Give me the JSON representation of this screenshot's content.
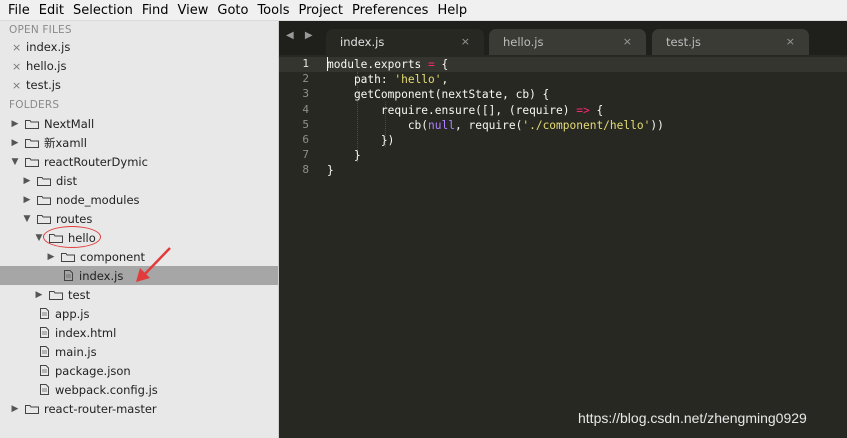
{
  "menu": [
    "File",
    "Edit",
    "Selection",
    "Find",
    "View",
    "Goto",
    "Tools",
    "Project",
    "Preferences",
    "Help"
  ],
  "sidebar": {
    "open_files_title": "OPEN FILES",
    "open_files": [
      "index.js",
      "hello.js",
      "test.js"
    ],
    "close_glyph": "×",
    "folders_title": "FOLDERS",
    "tree": [
      {
        "label": "NextMall",
        "type": "folder"
      },
      {
        "label": "新xamll",
        "type": "folder"
      },
      {
        "label": "reactRouterDymic",
        "type": "folder"
      },
      {
        "label": "dist",
        "type": "folder"
      },
      {
        "label": "node_modules",
        "type": "folder"
      },
      {
        "label": "routes",
        "type": "folder"
      },
      {
        "label": "hello",
        "type": "folder"
      },
      {
        "label": "component",
        "type": "folder"
      },
      {
        "label": "index.js",
        "type": "file"
      },
      {
        "label": "test",
        "type": "folder"
      },
      {
        "label": "app.js",
        "type": "file"
      },
      {
        "label": "index.html",
        "type": "file"
      },
      {
        "label": "main.js",
        "type": "file"
      },
      {
        "label": "package.json",
        "type": "file"
      },
      {
        "label": "webpack.config.js",
        "type": "file"
      },
      {
        "label": "react-router-master",
        "type": "folder"
      }
    ]
  },
  "editor": {
    "nav_arrows": "◀ ▶",
    "tabs": [
      {
        "label": "index.js",
        "close": "×",
        "active": true
      },
      {
        "label": "hello.js",
        "close": "×",
        "active": false
      },
      {
        "label": "test.js",
        "close": "×",
        "active": false
      }
    ],
    "line_numbers": [
      "1",
      "2",
      "3",
      "4",
      "5",
      "6",
      "7",
      "8"
    ],
    "code_lines": [
      [
        {
          "t": "module.exports ",
          "c": ""
        },
        {
          "t": "=",
          "c": "op"
        },
        {
          "t": " {",
          "c": ""
        }
      ],
      [
        {
          "t": "    path: ",
          "c": ""
        },
        {
          "t": "'hello'",
          "c": "str"
        },
        {
          "t": ",",
          "c": ""
        }
      ],
      [
        {
          "t": "    getComponent(nextState, cb) {",
          "c": ""
        }
      ],
      [
        {
          "t": "        require.ensure([], (require) ",
          "c": ""
        },
        {
          "t": "=>",
          "c": "op"
        },
        {
          "t": " {",
          "c": ""
        }
      ],
      [
        {
          "t": "            cb(",
          "c": ""
        },
        {
          "t": "null",
          "c": "cst"
        },
        {
          "t": ", require(",
          "c": ""
        },
        {
          "t": "'./component/hello'",
          "c": "str"
        },
        {
          "t": "))",
          "c": ""
        }
      ],
      [
        {
          "t": "        })",
          "c": ""
        }
      ],
      [
        {
          "t": "    }",
          "c": ""
        }
      ],
      [
        {
          "t": "}",
          "c": ""
        }
      ]
    ]
  },
  "watermark": "https://blog.csdn.net/zhengming0929",
  "colors": {
    "annotation": "#e23b3b",
    "selected_row": "#a6a6a6",
    "editor_bg": "#272822"
  }
}
